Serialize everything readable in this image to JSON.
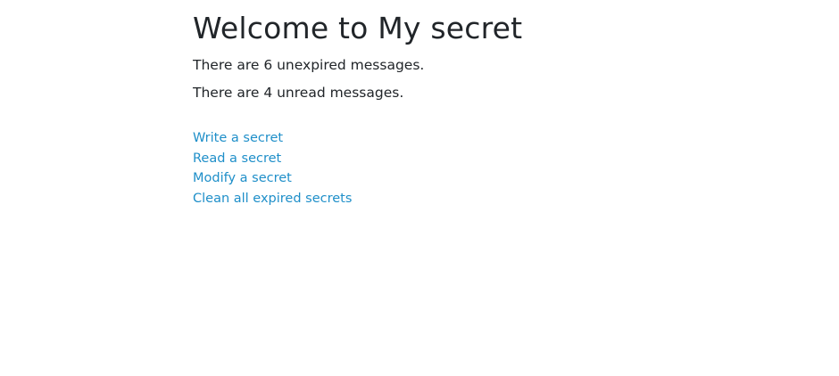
{
  "page": {
    "title": "Welcome to My secret"
  },
  "stats": {
    "unexpired": "There are 6 unexpired messages.",
    "unread": "There are 4 unread messages."
  },
  "links": [
    {
      "label": "Write a secret"
    },
    {
      "label": "Read a secret"
    },
    {
      "label": "Modify a secret"
    },
    {
      "label": "Clean all expired secrets"
    }
  ],
  "colors": {
    "text": "#212529",
    "link": "#1f8fc9",
    "background": "#ffffff"
  }
}
